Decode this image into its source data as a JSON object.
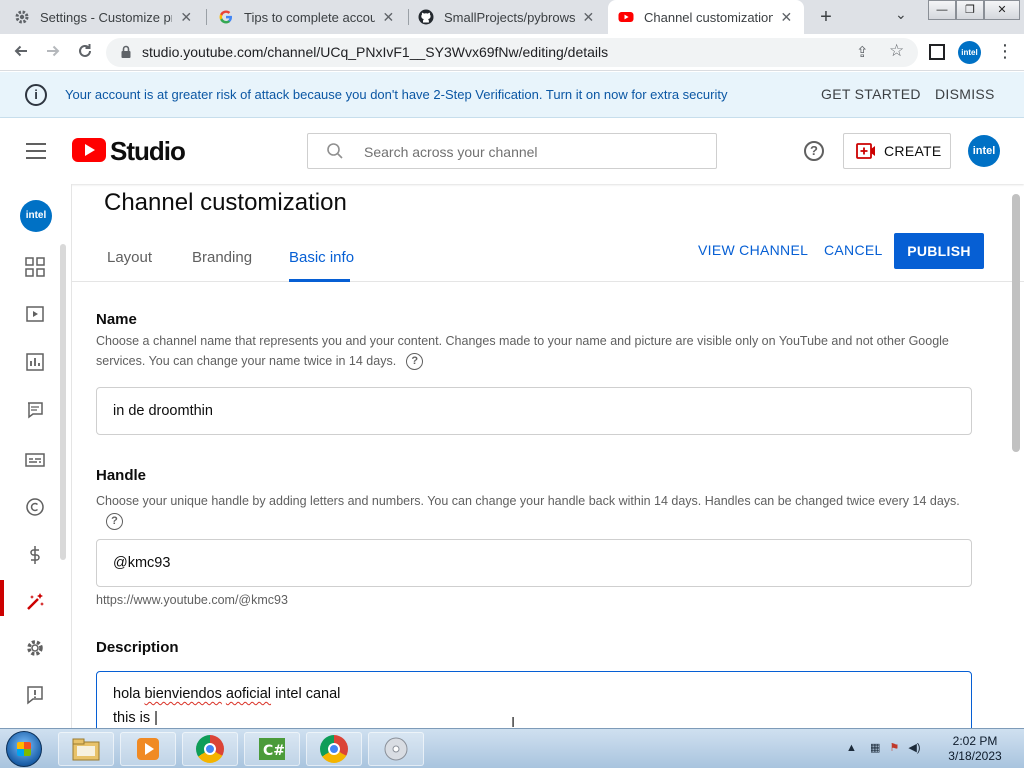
{
  "browser": {
    "tabs": [
      {
        "title": "Settings - Customize pro",
        "icon": "gear-icon",
        "active": false
      },
      {
        "title": "Tips to complete account",
        "icon": "google-icon",
        "active": false
      },
      {
        "title": "SmallProjects/pybrowser",
        "icon": "github-icon",
        "active": false
      },
      {
        "title": "Channel customization -",
        "icon": "youtube-icon",
        "active": true
      }
    ],
    "new_tab": "+",
    "tab_search": "⌄",
    "window_controls": {
      "minimize": "—",
      "restore": "❐",
      "close": "✕"
    },
    "url": "studio.youtube.com/channel/UCq_PNxIvF1__SY3Wvx69fNw/editing/details",
    "profile_label": "intel"
  },
  "banner": {
    "message": "Your account is at greater risk of attack because you don't have 2-Step Verification. Turn it on now for extra security",
    "get_started": "GET STARTED",
    "dismiss": "DISMISS",
    "info_glyph": "i"
  },
  "header": {
    "logo_text": "Studio",
    "search_placeholder": "Search across your channel",
    "help_glyph": "?",
    "create_label": "CREATE",
    "avatar_label": "intel"
  },
  "rail": {
    "avatar_label": "intel",
    "items": [
      "dashboard-icon",
      "content-icon",
      "analytics-icon",
      "comments-icon",
      "subtitles-icon",
      "copyright-icon",
      "earn-icon",
      "customization-icon",
      "settings-icon",
      "feedback-icon"
    ],
    "active_item": "customization-icon"
  },
  "page": {
    "title": "Channel customization",
    "tabs": [
      "Layout",
      "Branding",
      "Basic info"
    ],
    "active_tab": "Basic info",
    "view_channel": "VIEW CHANNEL",
    "cancel": "CANCEL",
    "publish": "PUBLISH"
  },
  "name_section": {
    "title": "Name",
    "description": "Choose a channel name that represents you and your content. Changes made to your name and picture are visible only on YouTube and not other Google services. You can change your name twice in 14 days.",
    "value": "in de droomthin"
  },
  "handle_section": {
    "title": "Handle",
    "description": "Choose your unique handle by adding letters and numbers. You can change your handle back within 14 days. Handles can be changed twice every 14 days.",
    "value": "@kmc93",
    "url": "https://www.youtube.com/@kmc93"
  },
  "description_section": {
    "title": "Description",
    "line1_a": "hola",
    "line1_b": "bienviendos",
    "line1_c": "aoficial",
    "line1_d": "intel canal",
    "line2": "this is"
  },
  "taskbar": {
    "time": "2:02 PM",
    "date": "3/18/2023",
    "show_hidden": "▲",
    "apps": [
      "explorer-icon",
      "media-player-icon",
      "chrome-icon",
      "csharp-icon",
      "chrome-icon",
      "disc-icon"
    ]
  },
  "colors": {
    "accent_blue": "#065fd4",
    "youtube_red": "#ff0000",
    "intel_blue": "#0071c5",
    "banner_bg": "#e8f4fb"
  }
}
